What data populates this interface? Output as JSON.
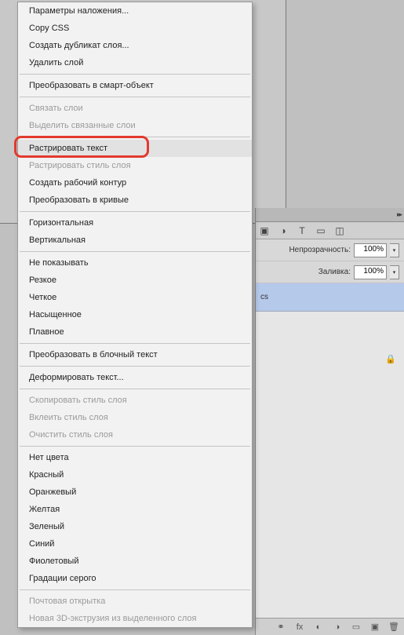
{
  "menu": {
    "groups": [
      [
        {
          "label": "Параметры наложения...",
          "disabled": false
        },
        {
          "label": "Copy CSS",
          "disabled": false
        },
        {
          "label": "Создать дубликат слоя...",
          "disabled": false
        },
        {
          "label": "Удалить слой",
          "disabled": false
        }
      ],
      [
        {
          "label": "Преобразовать в смарт-объект",
          "disabled": false
        }
      ],
      [
        {
          "label": "Связать слои",
          "disabled": true
        },
        {
          "label": "Выделить связанные слои",
          "disabled": true
        }
      ],
      [
        {
          "label": "Растрировать текст",
          "disabled": false,
          "highlighted": true
        },
        {
          "label": "Растрировать стиль слоя",
          "disabled": true
        },
        {
          "label": "Создать рабочий контур",
          "disabled": false
        },
        {
          "label": "Преобразовать в кривые",
          "disabled": false
        }
      ],
      [
        {
          "label": "Горизонтальная",
          "disabled": false
        },
        {
          "label": "Вертикальная",
          "disabled": false
        }
      ],
      [
        {
          "label": "Не показывать",
          "disabled": false
        },
        {
          "label": "Резкое",
          "disabled": false
        },
        {
          "label": "Четкое",
          "disabled": false
        },
        {
          "label": "Насыщенное",
          "disabled": false
        },
        {
          "label": "Плавное",
          "disabled": false
        }
      ],
      [
        {
          "label": "Преобразовать в блочный текст",
          "disabled": false
        }
      ],
      [
        {
          "label": "Деформировать текст...",
          "disabled": false
        }
      ],
      [
        {
          "label": "Скопировать стиль слоя",
          "disabled": true
        },
        {
          "label": "Вклеить стиль слоя",
          "disabled": true
        },
        {
          "label": "Очистить стиль слоя",
          "disabled": true
        }
      ],
      [
        {
          "label": "Нет цвета",
          "disabled": false
        },
        {
          "label": "Красный",
          "disabled": false
        },
        {
          "label": "Оранжевый",
          "disabled": false
        },
        {
          "label": "Желтая",
          "disabled": false
        },
        {
          "label": "Зеленый",
          "disabled": false
        },
        {
          "label": "Синий",
          "disabled": false
        },
        {
          "label": "Фиолетовый",
          "disabled": false
        },
        {
          "label": "Градации серого",
          "disabled": false
        }
      ],
      [
        {
          "label": "Почтовая открытка",
          "disabled": true
        },
        {
          "label": "Новая 3D-экструзия из выделенного слоя",
          "disabled": true
        }
      ]
    ]
  },
  "panel": {
    "opacity_label": "Непрозрачность:",
    "opacity_value": "100%",
    "fill_label": "Заливка:",
    "fill_value": "100%",
    "layer_name": "cs"
  }
}
